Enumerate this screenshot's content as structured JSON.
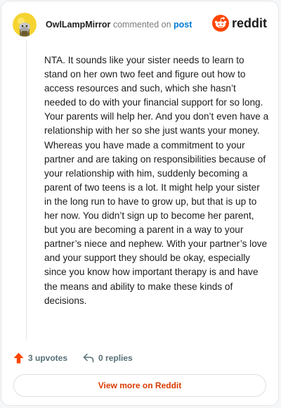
{
  "comment": {
    "username": "OwlLampMirror",
    "commented_text": "commented on",
    "post_link": "post",
    "body": "NTA. It sounds like your sister needs to learn to stand on her own two feet and figure out how to access resources and such, which she hasn’t needed to do with your financial support for so long. Your parents will help her. And you don’t even have a relationship with her so she just wants your money. Whereas you have made a commitment to your partner and are taking on responsibilities because of your relationship with him, suddenly becoming a parent of two teens is a lot. It might help your sister in the long run to have to grow up, but that is up to her now. You didn’t sign up to become her parent, but you are becoming a parent in a way to your partner’s niece and nephew. With your partner’s love and your support they should be okay, especially since you know how important therapy is and have the means and ability to make these kinds of decisions."
  },
  "brand": {
    "name": "reddit",
    "icon": "reddit-logo-icon",
    "color": "#ff4500"
  },
  "actions": {
    "upvotes": "3 upvotes",
    "upvote_icon": "upvote-arrow-icon",
    "upvote_color": "#ff4500",
    "replies": "0 replies",
    "reply_icon": "reply-arrow-icon"
  },
  "footer": {
    "view_more": "View more on Reddit",
    "accent": "#d93a00"
  }
}
